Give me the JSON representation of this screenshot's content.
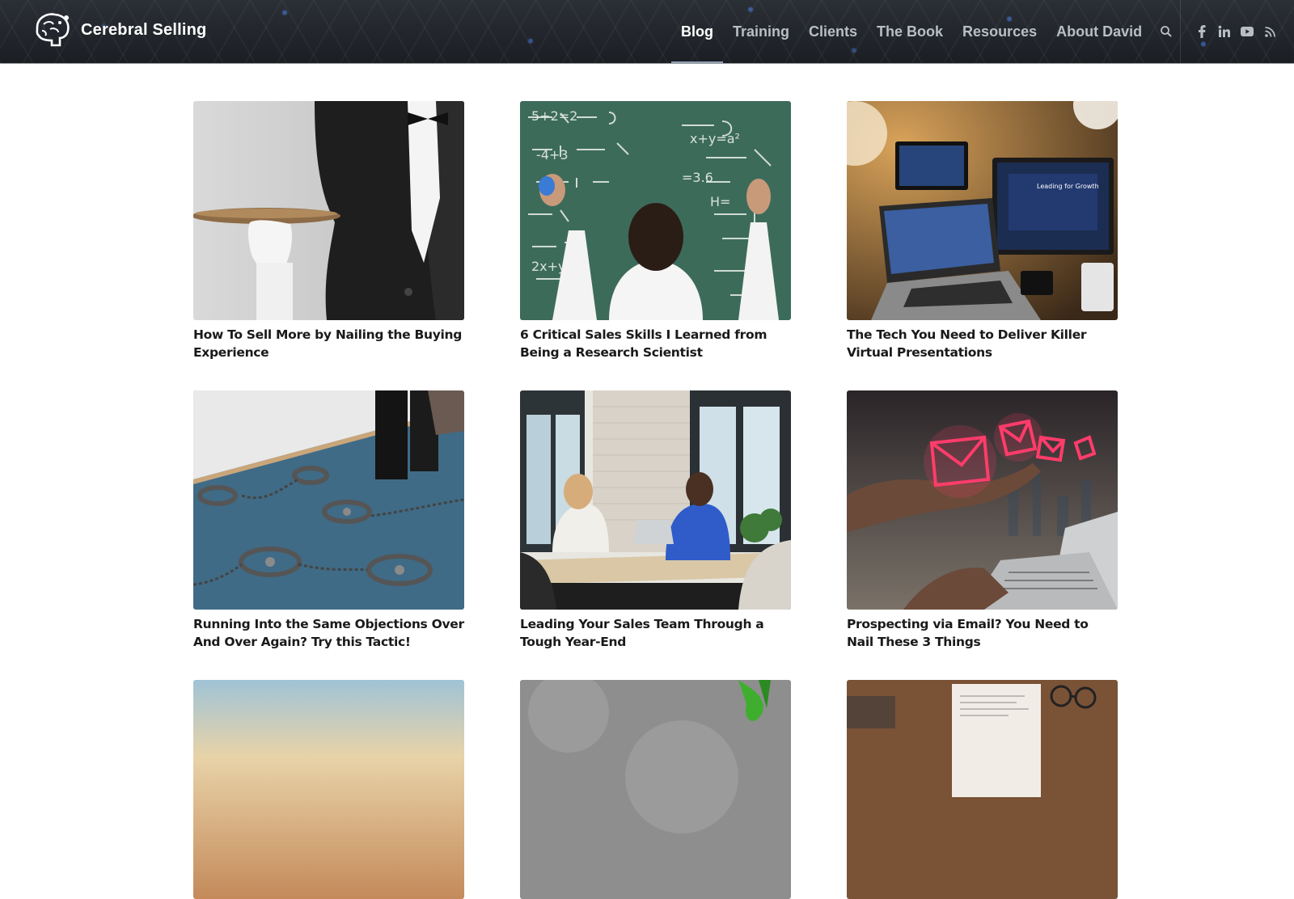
{
  "brand": {
    "name": "Cerebral Selling",
    "logo_icon": "brain-head-logo-icon"
  },
  "nav": {
    "items": [
      {
        "label": "Blog",
        "active": true
      },
      {
        "label": "Training",
        "active": false
      },
      {
        "label": "Clients",
        "active": false
      },
      {
        "label": "The Book",
        "active": false
      },
      {
        "label": "Resources",
        "active": false
      },
      {
        "label": "About David",
        "active": false
      }
    ],
    "search_icon": "search-icon"
  },
  "social": [
    "facebook-icon",
    "linkedin-icon",
    "youtube-icon",
    "rss-icon"
  ],
  "colors": {
    "header_bg": "#1f2227",
    "nav_text": "#b9bec6",
    "nav_active": "#ffffff",
    "title_text": "#1a1a1a"
  },
  "posts": [
    {
      "title": "How To Sell More by Nailing the Buying Experience",
      "image": "butler-with-tray"
    },
    {
      "title": "6 Critical Sales Skills I Learned from Being a Research Scientist",
      "image": "man-at-chalkboard"
    },
    {
      "title": "The Tech You Need to Deliver Killer Virtual Presentations",
      "image": "laptop-monitor-setup"
    },
    {
      "title": "Running Into the Same Objections Over And Over Again? Try this Tactic!",
      "image": "bear-traps-on-carpet"
    },
    {
      "title": "Leading Your Sales Team Through a Tough Year-End",
      "image": "stressed-team-meeting"
    },
    {
      "title": "Prospecting via Email? You Need to Nail These 3 Things",
      "image": "glowing-email-envelopes"
    },
    {
      "title": "",
      "image": "sky-gradient"
    },
    {
      "title": "",
      "image": "grey-stone-green-ribbon"
    },
    {
      "title": "",
      "image": "desk-with-paper-glasses"
    }
  ]
}
